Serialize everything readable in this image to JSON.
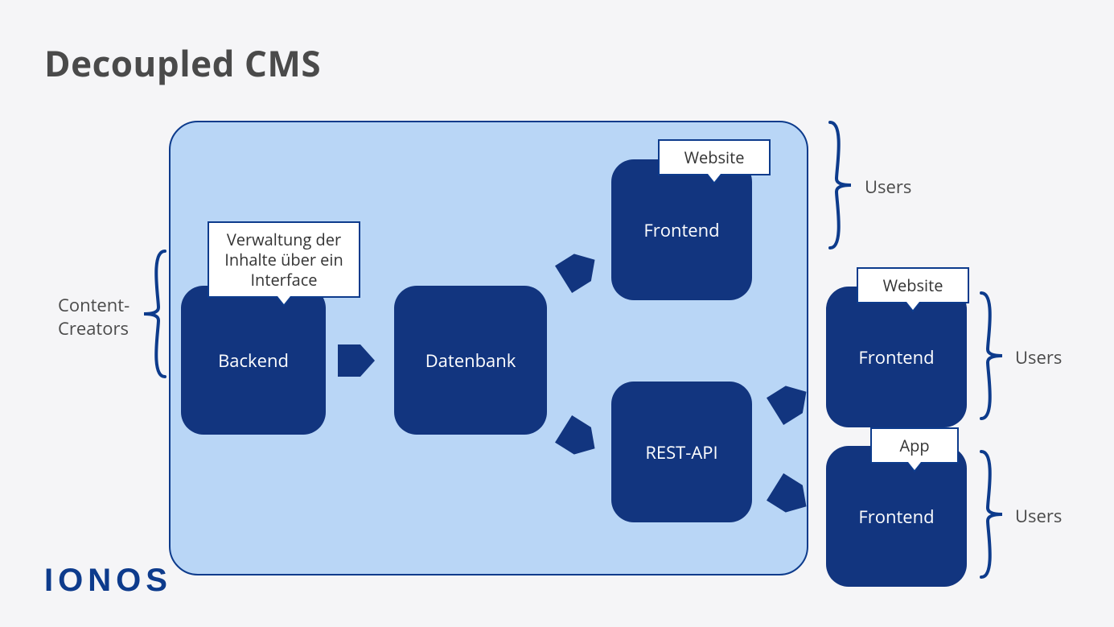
{
  "title": "Decoupled CMS",
  "logo": "IONOS",
  "labels": {
    "content_creators": "Content-\nCreators",
    "users": "Users"
  },
  "nodes": {
    "backend": "Backend",
    "datenbank": "Datenbank",
    "frontend_a": "Frontend",
    "rest_api": "REST-API",
    "frontend_b": "Frontend",
    "frontend_c": "Frontend"
  },
  "callouts": {
    "backend": "Verwaltung der\nInhalte über ein\nInterface",
    "frontend_a": "Website",
    "frontend_b": "Website",
    "frontend_c": "App"
  },
  "flow": {
    "edges": [
      {
        "from": "backend",
        "to": "datenbank"
      },
      {
        "from": "datenbank",
        "to": "frontend_a"
      },
      {
        "from": "datenbank",
        "to": "rest_api"
      },
      {
        "from": "rest_api",
        "to": "frontend_b"
      },
      {
        "from": "rest_api",
        "to": "frontend_c"
      }
    ],
    "audiences": {
      "backend": "Content-Creators",
      "frontend_a": "Users",
      "frontend_b": "Users",
      "frontend_c": "Users"
    }
  }
}
